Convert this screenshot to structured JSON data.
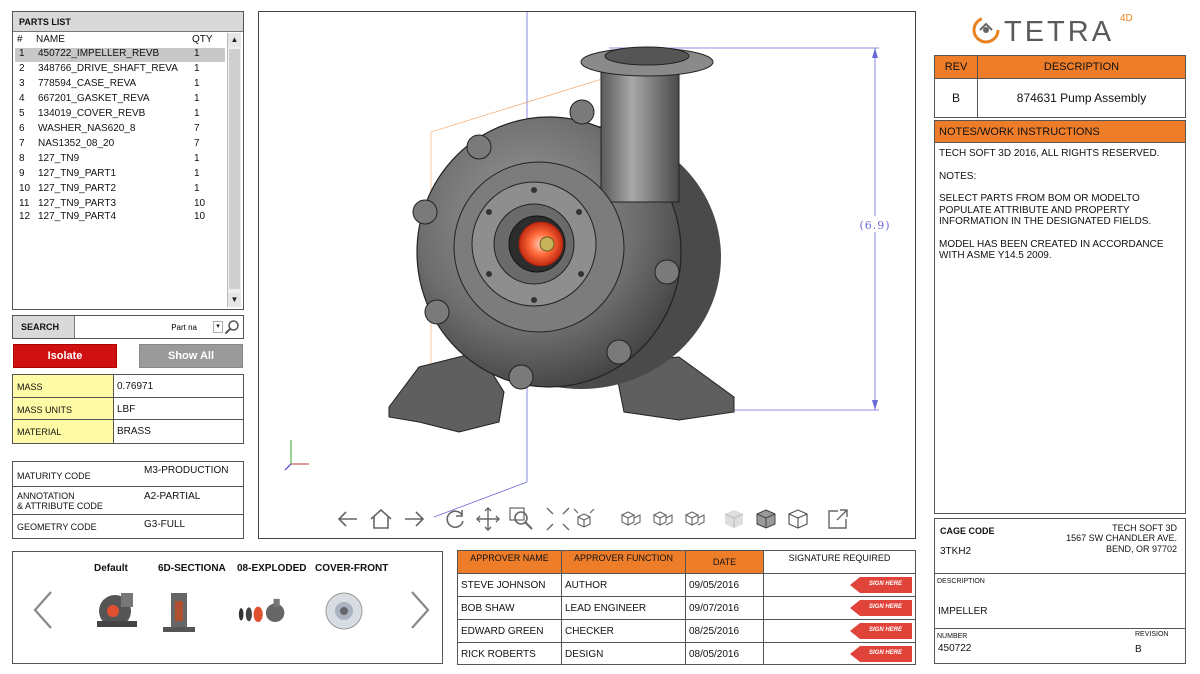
{
  "parts_list": {
    "title": "PARTS LIST",
    "columns": {
      "num": "#",
      "name": "NAME",
      "qty": "QTY"
    },
    "rows": [
      {
        "num": "1",
        "name": "450722_IMPELLER_REVB",
        "qty": "1",
        "selected": true
      },
      {
        "num": "2",
        "name": "348766_DRIVE_SHAFT_REVA",
        "qty": "1"
      },
      {
        "num": "3",
        "name": "778594_CASE_REVA",
        "qty": "1"
      },
      {
        "num": "4",
        "name": "667201_GASKET_REVA",
        "qty": "1"
      },
      {
        "num": "5",
        "name": "134019_COVER_REVB",
        "qty": "1"
      },
      {
        "num": "6",
        "name": "WASHER_NAS620_8",
        "qty": "7"
      },
      {
        "num": "7",
        "name": "NAS1352_08_20",
        "qty": "7"
      },
      {
        "num": "8",
        "name": "127_TN9",
        "qty": "1"
      },
      {
        "num": "9",
        "name": "127_TN9_PART1",
        "qty": "1"
      },
      {
        "num": "10",
        "name": "127_TN9_PART2",
        "qty": "1"
      },
      {
        "num": "11",
        "name": "127_TN9_PART3",
        "qty": "10"
      },
      {
        "num": "12",
        "name": "127_TN9_PART4",
        "qty": "10"
      }
    ]
  },
  "search": {
    "label": "SEARCH",
    "field_value": "Part na"
  },
  "buttons": {
    "isolate": "Isolate",
    "show_all": "Show All"
  },
  "properties": [
    {
      "key": "MASS",
      "value": "0.76971"
    },
    {
      "key": "MASS UNITS",
      "value": "LBF"
    },
    {
      "key": "MATERIAL",
      "value": "BRASS"
    }
  ],
  "codes": {
    "maturity": {
      "label": "MATURITY CODE",
      "value": "M3-PRODUCTION"
    },
    "annotation_line1": "ANNOTATION",
    "annotation_line2": "& ATTRIBUTE CODE",
    "annotation_value": "A2-PARTIAL",
    "geometry": {
      "label": "GEOMETRY CODE",
      "value": "G3-FULL"
    }
  },
  "viewport": {
    "dimension_label": "(6.9)",
    "toolbar_icons": [
      "arrow-left-icon",
      "home-icon",
      "arrow-right-icon",
      "rotate-icon",
      "pan-icon",
      "zoom-window-icon",
      "fit-icon",
      "explode-icon",
      "view-iso-icon",
      "view-top-icon",
      "view-side-icon",
      "shaded-icon",
      "shaded-edges-icon",
      "wireframe-icon",
      "fullscreen-icon"
    ]
  },
  "logo": {
    "brand": "TETRA",
    "super": "4D",
    "accent": "#e8821c"
  },
  "revision": {
    "rev_header": "REV",
    "desc_header": "DESCRIPTION",
    "rev": "B",
    "description": "874631 Pump Assembly"
  },
  "notes": {
    "header": "NOTES/WORK INSTRUCTIONS",
    "copyright": "TECH SOFT 3D 2016, ALL RIGHTS RESERVED.",
    "notes_label": "NOTES:",
    "instructions": "SELECT PARTS  FROM BOM OR MODELTO POPULATE ATTRIBUTE AND PROPERTY INFORMATION IN THE DESIGNATED FIELDS.",
    "compliance": "MODEL HAS BEEN CREATED IN ACCORDANCE WITH ASME Y14.5 2009."
  },
  "title_block": {
    "cage_label": "CAGE CODE",
    "cage_value": "3TKH2",
    "company_line1": "TECH SOFT 3D",
    "company_line2": "1567 SW CHANDLER AVE.",
    "company_line3": "BEND, OR 97702",
    "description_label": "DESCRIPTION",
    "description_value": "IMPELLER",
    "number_label": "NUMBER",
    "number_value": "450722",
    "revision_label": "REVISION",
    "revision_value": "B"
  },
  "views": {
    "labels": [
      "Default",
      "6D-SECTIONA",
      "08-EXPLODED",
      "COVER-FRONT"
    ]
  },
  "approvers": {
    "headers": {
      "approver": "APPROVER NAME",
      "function": "APPROVER FUNCTION",
      "date": "DATE",
      "signature": "SIGNATURE REQUIRED"
    },
    "sign_label": "SIGN HERE",
    "rows": [
      {
        "name": "STEVE JOHNSON",
        "function": "AUTHOR",
        "date": "09/05/2016"
      },
      {
        "name": "BOB SHAW",
        "function": "LEAD ENGINEER",
        "date": "09/07/2016"
      },
      {
        "name": "EDWARD GREEN",
        "function": "CHECKER",
        "date": "08/25/2016"
      },
      {
        "name": "RICK ROBERTS",
        "function": "DESIGN",
        "date": "08/05/2016"
      }
    ]
  },
  "colors": {
    "header_orange": "#ee7d2a",
    "isolate_red": "#d01010",
    "property_yellow": "#fffaa6",
    "sign_red": "#e0433a"
  }
}
